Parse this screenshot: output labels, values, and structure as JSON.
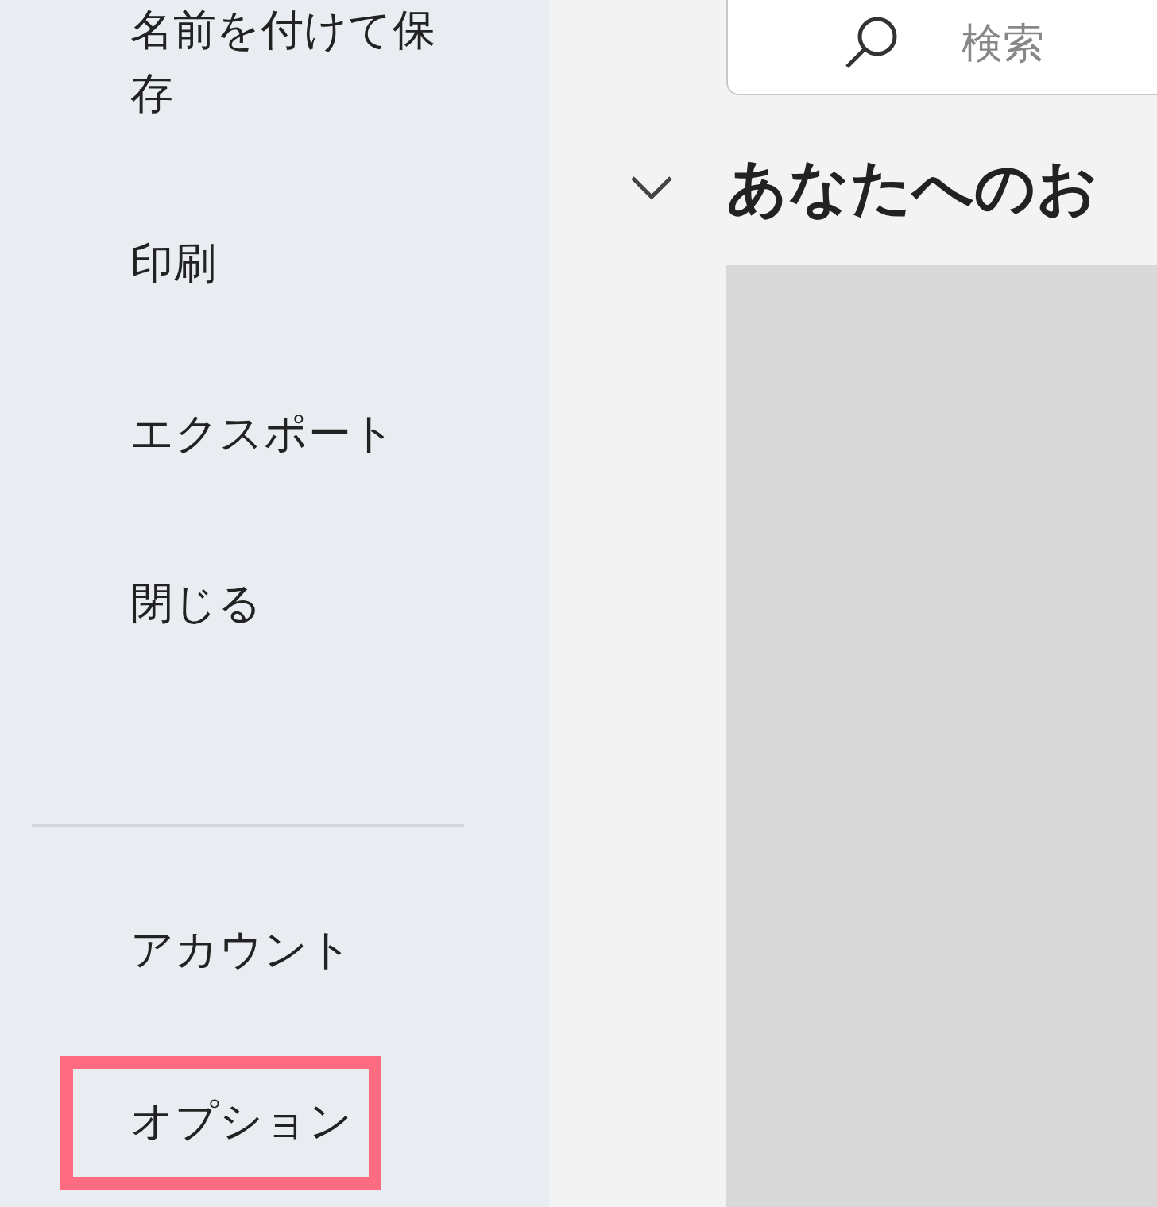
{
  "sidebar": {
    "items": [
      {
        "label": "名前を付けて保存",
        "highlighted": false
      },
      {
        "label": "印刷",
        "highlighted": false
      },
      {
        "label": "エクスポート",
        "highlighted": false
      },
      {
        "label": "閉じる",
        "highlighted": false
      }
    ],
    "bottom_items": [
      {
        "label": "アカウント",
        "highlighted": false
      },
      {
        "label": "オプション",
        "highlighted": true
      }
    ]
  },
  "search": {
    "placeholder": "検索"
  },
  "section": {
    "title": "あなたへのお",
    "expanded": true
  }
}
